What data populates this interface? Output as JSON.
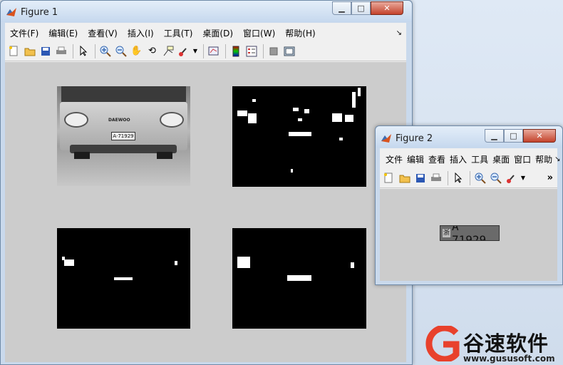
{
  "figure1": {
    "title": "Figure 1",
    "menu": [
      "文件(F)",
      "编辑(E)",
      "查看(V)",
      "插入(I)",
      "工具(T)",
      "桌面(D)",
      "窗口(W)",
      "帮助(H)"
    ],
    "menu_arrow": "↘",
    "toolbar_icons": [
      "new-figure-icon",
      "open-icon",
      "save-icon",
      "print-icon",
      "pointer-icon",
      "zoom-in-icon",
      "zoom-out-icon",
      "pan-icon",
      "rotate-icon",
      "data-cursor-icon",
      "brush-icon",
      "link-plot-icon",
      "colorbar-icon",
      "legend-icon",
      "hide-plot-tools-icon",
      "show-plot-tools-icon"
    ],
    "bus_brand": "DAEWOO",
    "bus_plate": "A·71929"
  },
  "figure2": {
    "title": "Figure 2",
    "menu": [
      "文件",
      "编辑",
      "查看",
      "插入",
      "工具",
      "桌面",
      "窗口",
      "帮助"
    ],
    "menu_arrow": "↘",
    "overflow_label": "»",
    "plate_text": "A 71929",
    "plate_prefix": "浙"
  },
  "watermark": {
    "brand": "谷速软件",
    "url": "www.gususoft.com"
  },
  "colors": {
    "accent": "#e8412c",
    "fig_bg": "#cccccc"
  }
}
